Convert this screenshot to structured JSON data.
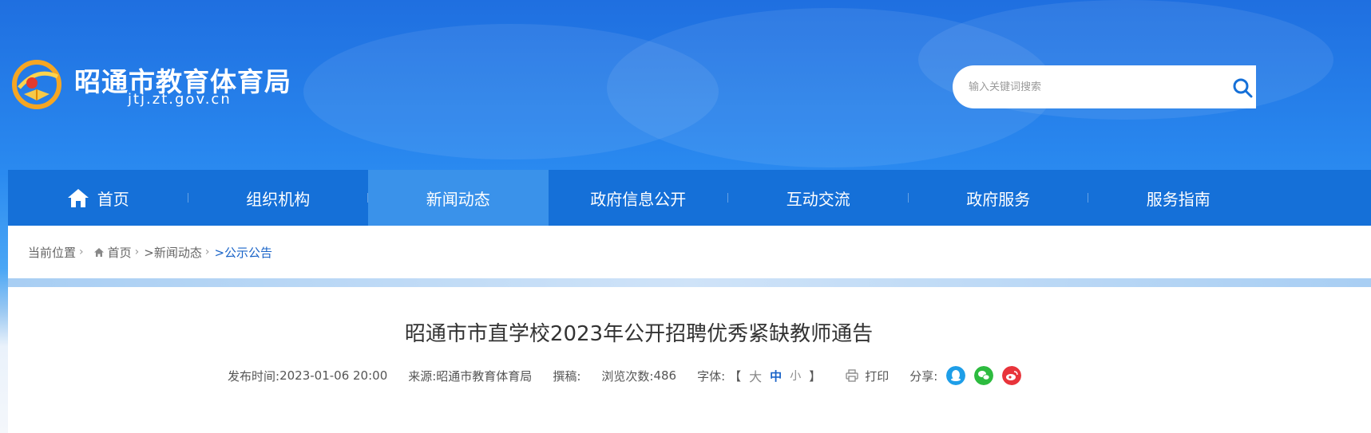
{
  "colors": {
    "nav_bg": "#1570d8",
    "nav_active_bg": "#3a92ea",
    "breadcrumb_current": "#1a64c8",
    "share_qq": "#1e9ee8",
    "share_wechat": "#2dbb3f",
    "share_weibo": "#e8343b"
  },
  "header": {
    "title": "昭通市教育体育局",
    "domain": "jtj.zt.gov.cn"
  },
  "search": {
    "placeholder": "输入关键词搜索",
    "value": "",
    "icon": "search-icon"
  },
  "nav": {
    "active_index": 2,
    "items": [
      {
        "label": "首页",
        "icon": "home-icon"
      },
      {
        "label": "组织机构"
      },
      {
        "label": "新闻动态"
      },
      {
        "label": "政府信息公开"
      },
      {
        "label": "互动交流"
      },
      {
        "label": "政府服务"
      },
      {
        "label": "服务指南"
      }
    ]
  },
  "breadcrumb": {
    "prefix": "当前位置",
    "items": [
      "首页",
      ">新闻动态",
      ">公示公告"
    ]
  },
  "article": {
    "title": "昭通市市直学校2023年公开招聘优秀紧缺教师通告",
    "meta": {
      "publish_label": "发布时间:",
      "publish_time": "2023-01-06 20:00",
      "source_label": "来源:",
      "source": "昭通市教育体育局",
      "author_label": "撰稿:",
      "author": "",
      "views_label": "浏览次数:",
      "views": "486",
      "font_label": "字体:",
      "font_open": "【",
      "font_large": "大",
      "font_medium": "中",
      "font_small": "小",
      "font_close": "】",
      "print_label": "打印",
      "share_label": "分享:"
    }
  }
}
